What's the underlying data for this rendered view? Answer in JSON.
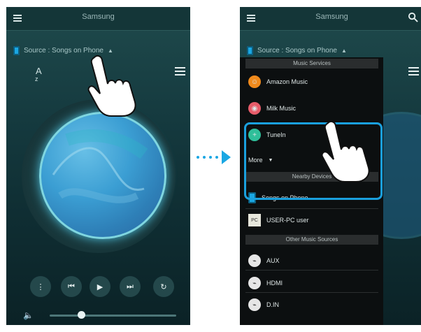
{
  "left_screen": {
    "title": "Samsung",
    "source_label": "Source : Songs on Phone",
    "caret": "▲",
    "az_top": "A",
    "az_bottom": "z",
    "controls": {
      "more": "⋮",
      "prev": "⏮",
      "play": "▶",
      "next": "⏭",
      "repeat": "↻"
    },
    "volume_icon": "🔈",
    "progress_fraction": 0.25
  },
  "right_screen": {
    "title": "Samsung",
    "source_label": "Source : Songs on Phone",
    "caret": "▲",
    "music_services_header": "Music Services",
    "services": [
      "Amazon Music",
      "Milk Music",
      "TuneIn"
    ],
    "more_label": "More",
    "nearby_devices_header": "Nearby Devices",
    "nearby_devices": [
      "Songs on Phone",
      "USER-PC user"
    ],
    "other_sources_header": "Other Music Sources",
    "other_sources": [
      "AUX",
      "HDMI",
      "D.IN"
    ]
  },
  "colors": {
    "accent": "#1aa0de",
    "amazon": "#f08a1c",
    "milk": "#e85c6a",
    "tunein": "#2fbf9a"
  },
  "icons": [
    "menu-icon",
    "search-icon",
    "phone-icon",
    "pointer-hand-icon",
    "arrow-right-icon"
  ]
}
